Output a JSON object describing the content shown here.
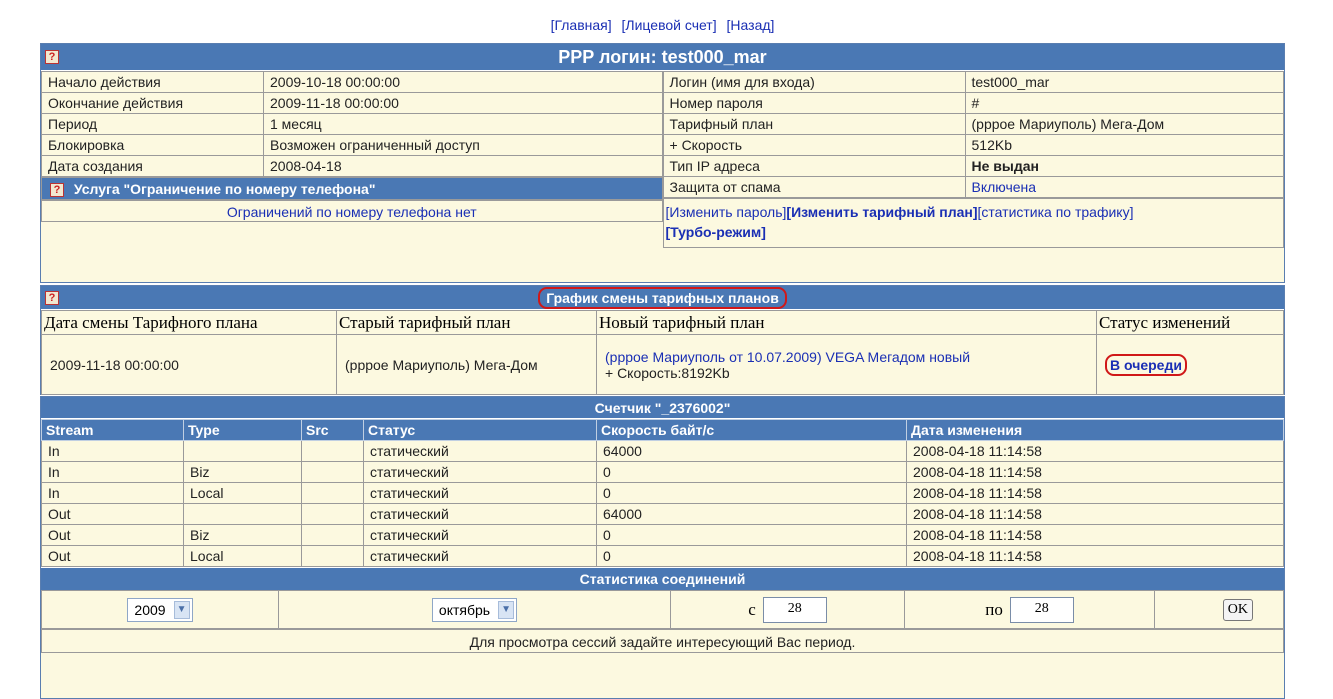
{
  "nav": {
    "main": "[Главная]",
    "account": "[Лицевой счет]",
    "back": "[Назад]"
  },
  "login_panel": {
    "title": "PPP логин: test000_mar",
    "left_rows": [
      {
        "label": "Начало действия",
        "value": "2009-10-18 00:00:00"
      },
      {
        "label": "Окончание действия",
        "value": "2009-11-18 00:00:00"
      },
      {
        "label": "Период",
        "value": "1 месяц"
      },
      {
        "label": "Блокировка",
        "value": "Возможен ограниченный доступ"
      },
      {
        "label": "Дата создания",
        "value": "2008-04-18"
      }
    ],
    "service_title": "Услуга \"Ограничение по номеру телефона\"",
    "service_msg": "Ограничений по номеру телефона нет",
    "right_rows": [
      {
        "label": "Логин (имя для входа)",
        "value": "test000_mar"
      },
      {
        "label": "Номер пароля",
        "value": "#"
      },
      {
        "label": "Тарифный план",
        "value": "(pppoe Мариуполь) Мега-Дом"
      },
      {
        "label": " + Скорость",
        "value": "512Kb"
      },
      {
        "label": "Тип IP адреса",
        "value": "Не выдан"
      },
      {
        "label": "Защита от спама",
        "value": "Включена"
      }
    ],
    "links": {
      "change_password": "[Изменить пароль]",
      "change_plan": "[Изменить тарифный план]",
      "traffic_stats": "[статистика по трафику]",
      "turbo": "[Турбо-режим]"
    }
  },
  "schedule": {
    "title": "График смены тарифных планов",
    "headers": [
      "Дата смены Тарифного плана",
      "Старый тарифный план",
      "Новый тарифный план",
      "Статус изменений"
    ],
    "row": {
      "date": "2009-11-18 00:00:00",
      "old_plan": "(pppoe Мариуполь) Мега-Дом",
      "new_plan": "(pppoe Мариуполь от 10.07.2009) VEGA Мегадом новый",
      "new_speed": " + Скорость:8192Kb",
      "status": "В очереди"
    }
  },
  "counter": {
    "title": "Счетчик \"_2376002\"",
    "headers": [
      "Stream",
      "Type",
      "Src",
      "Статус",
      "Скорость байт/с",
      "Дата изменения"
    ],
    "rows": [
      [
        "In",
        "",
        "",
        "статический",
        "64000",
        "2008-04-18 11:14:58"
      ],
      [
        "In",
        "Biz",
        "",
        "статический",
        "0",
        "2008-04-18 11:14:58"
      ],
      [
        "In",
        "Local",
        "",
        "статический",
        "0",
        "2008-04-18 11:14:58"
      ],
      [
        "Out",
        "",
        "",
        "статический",
        "64000",
        "2008-04-18 11:14:58"
      ],
      [
        "Out",
        "Biz",
        "",
        "статический",
        "0",
        "2008-04-18 11:14:58"
      ],
      [
        "Out",
        "Local",
        "",
        "статический",
        "0",
        "2008-04-18 11:14:58"
      ]
    ]
  },
  "stats": {
    "title": "Статистика соединений",
    "year": "2009",
    "month": "октябрь",
    "from_label": "с",
    "from_value": "28",
    "to_label": "по",
    "to_value": "28",
    "ok": "OK",
    "note": "Для просмотра сессий задайте интересующий Вас период."
  },
  "colors": {
    "header_bar": "#4a78b4",
    "panel_bg": "#fcf9e0",
    "link": "#1a2fb4",
    "highlight": "#d01818"
  }
}
